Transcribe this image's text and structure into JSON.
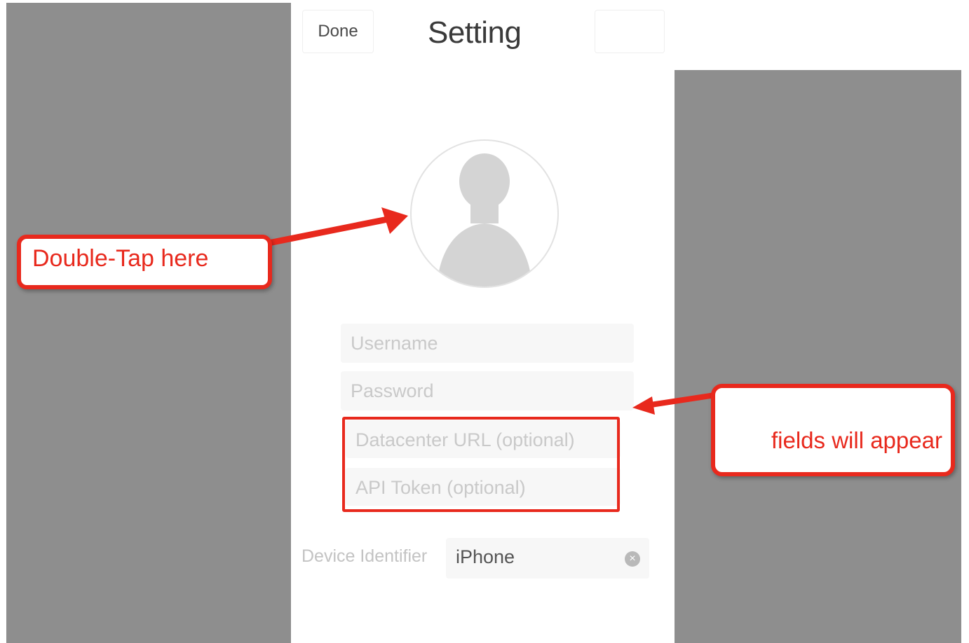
{
  "header": {
    "done_label": "Done",
    "title": "Setting"
  },
  "form": {
    "username_placeholder": "Username",
    "password_placeholder": "Password",
    "datacenter_placeholder": "Datacenter URL (optional)",
    "api_token_placeholder": "API Token (optional)",
    "device_identifier_label": "Device Identifier",
    "device_identifier_value": "iPhone"
  },
  "annotations": {
    "left_callout": "Double-Tap here",
    "right_callout": "fields will appear"
  },
  "colors": {
    "annotation_red": "#e8291d",
    "backdrop_gray": "#8e8e8e"
  },
  "icons": {
    "avatar": "person-silhouette-icon",
    "clear": "clear-x-icon"
  }
}
